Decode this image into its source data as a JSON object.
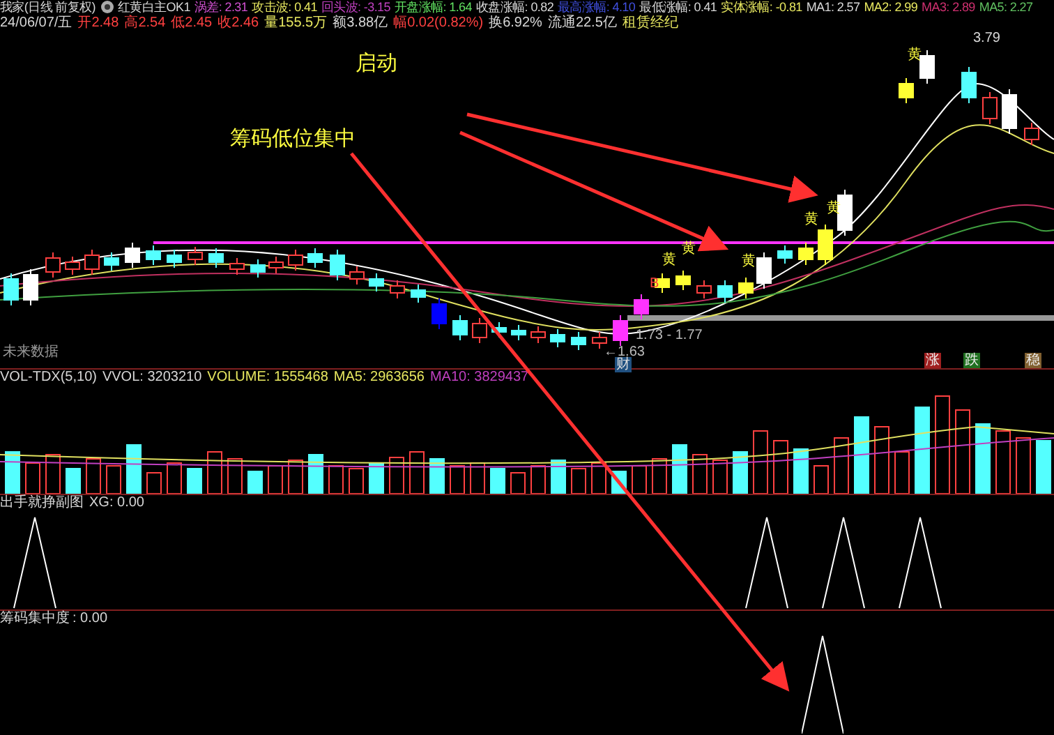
{
  "header": {
    "title": "我家(日线 前复权)",
    "formula": "红黄白主OK1",
    "indicators": [
      {
        "label": "涡差:",
        "value": "2.31",
        "color": "#d050d0"
      },
      {
        "label": "攻击波:",
        "value": "0.41",
        "color": "#e8e860"
      },
      {
        "label": "回头波:",
        "value": "-3.15",
        "color": "#c040c0"
      },
      {
        "label": "开盘涨幅:",
        "value": "1.64",
        "color": "#60e060"
      },
      {
        "label": "收盘涨幅:",
        "value": "0.82",
        "color": "#d8d8d8"
      },
      {
        "label": "最高涨幅:",
        "value": "4.10",
        "color": "#4050e0"
      },
      {
        "label": "最低涨幅:",
        "value": "0.41",
        "color": "#d8d8d8"
      },
      {
        "label": "实体涨幅:",
        "value": "-0.81",
        "color": "#e8e860"
      },
      {
        "label": "MA1:",
        "value": "2.57",
        "color": "#d8d8d8"
      },
      {
        "label": "MA2:",
        "value": "2.99",
        "color": "#e8e860"
      },
      {
        "label": "MA3:",
        "value": "2.89",
        "color": "#d03070"
      },
      {
        "label": "MA5:",
        "value": "2.27",
        "color": "#60c060"
      }
    ]
  },
  "quote": {
    "date": "24/06/07/五",
    "fields": [
      {
        "text": "开2.48",
        "color": "#ff4040"
      },
      {
        "text": "高2.54",
        "color": "#ff4040"
      },
      {
        "text": "低2.45",
        "color": "#ff4040"
      },
      {
        "text": "收2.46",
        "color": "#ff4040"
      },
      {
        "text": "量155.5万",
        "color": "#e8e860"
      },
      {
        "text": "额3.88亿",
        "color": "#d8d8d8"
      },
      {
        "text": "幅0.02(0.82%)",
        "color": "#ff4040"
      },
      {
        "text": "换6.92%",
        "color": "#d8d8d8"
      },
      {
        "text": "流通22.5亿",
        "color": "#d8d8d8"
      }
    ],
    "sector": "租赁经纪"
  },
  "main_chart": {
    "annotations": [
      "启动",
      "筹码低位集中"
    ],
    "signals": [
      "黄",
      "黄",
      "黄",
      "黄",
      "黄",
      "黄"
    ],
    "buy_mark": "B",
    "high_label": "3.79",
    "range_label": "1.73 - 1.77",
    "low_label": "←1.63",
    "finance_tag": "财",
    "future_note": "未来数据",
    "tags": [
      {
        "text": "涨",
        "color": "#a02020"
      },
      {
        "text": "跌",
        "color": "#207020"
      },
      {
        "text": "稳",
        "color": "#806030"
      }
    ]
  },
  "volume": {
    "title": "VOL-TDX(5,10)",
    "readings": [
      {
        "label": "VVOL:",
        "value": "3203210",
        "color": "#d8d8d8"
      },
      {
        "label": "VOLUME:",
        "value": "1555468",
        "color": "#e8e860"
      },
      {
        "label": "MA5:",
        "value": "2963656",
        "color": "#e8e860"
      },
      {
        "label": "MA10:",
        "value": "3829437",
        "color": "#c040c0"
      }
    ]
  },
  "xg_panel": {
    "title": "出手就挣副图",
    "reading": "XG: 0.00"
  },
  "chip_panel": {
    "title": "筹码集中度",
    "reading": ": 0.00"
  }
}
